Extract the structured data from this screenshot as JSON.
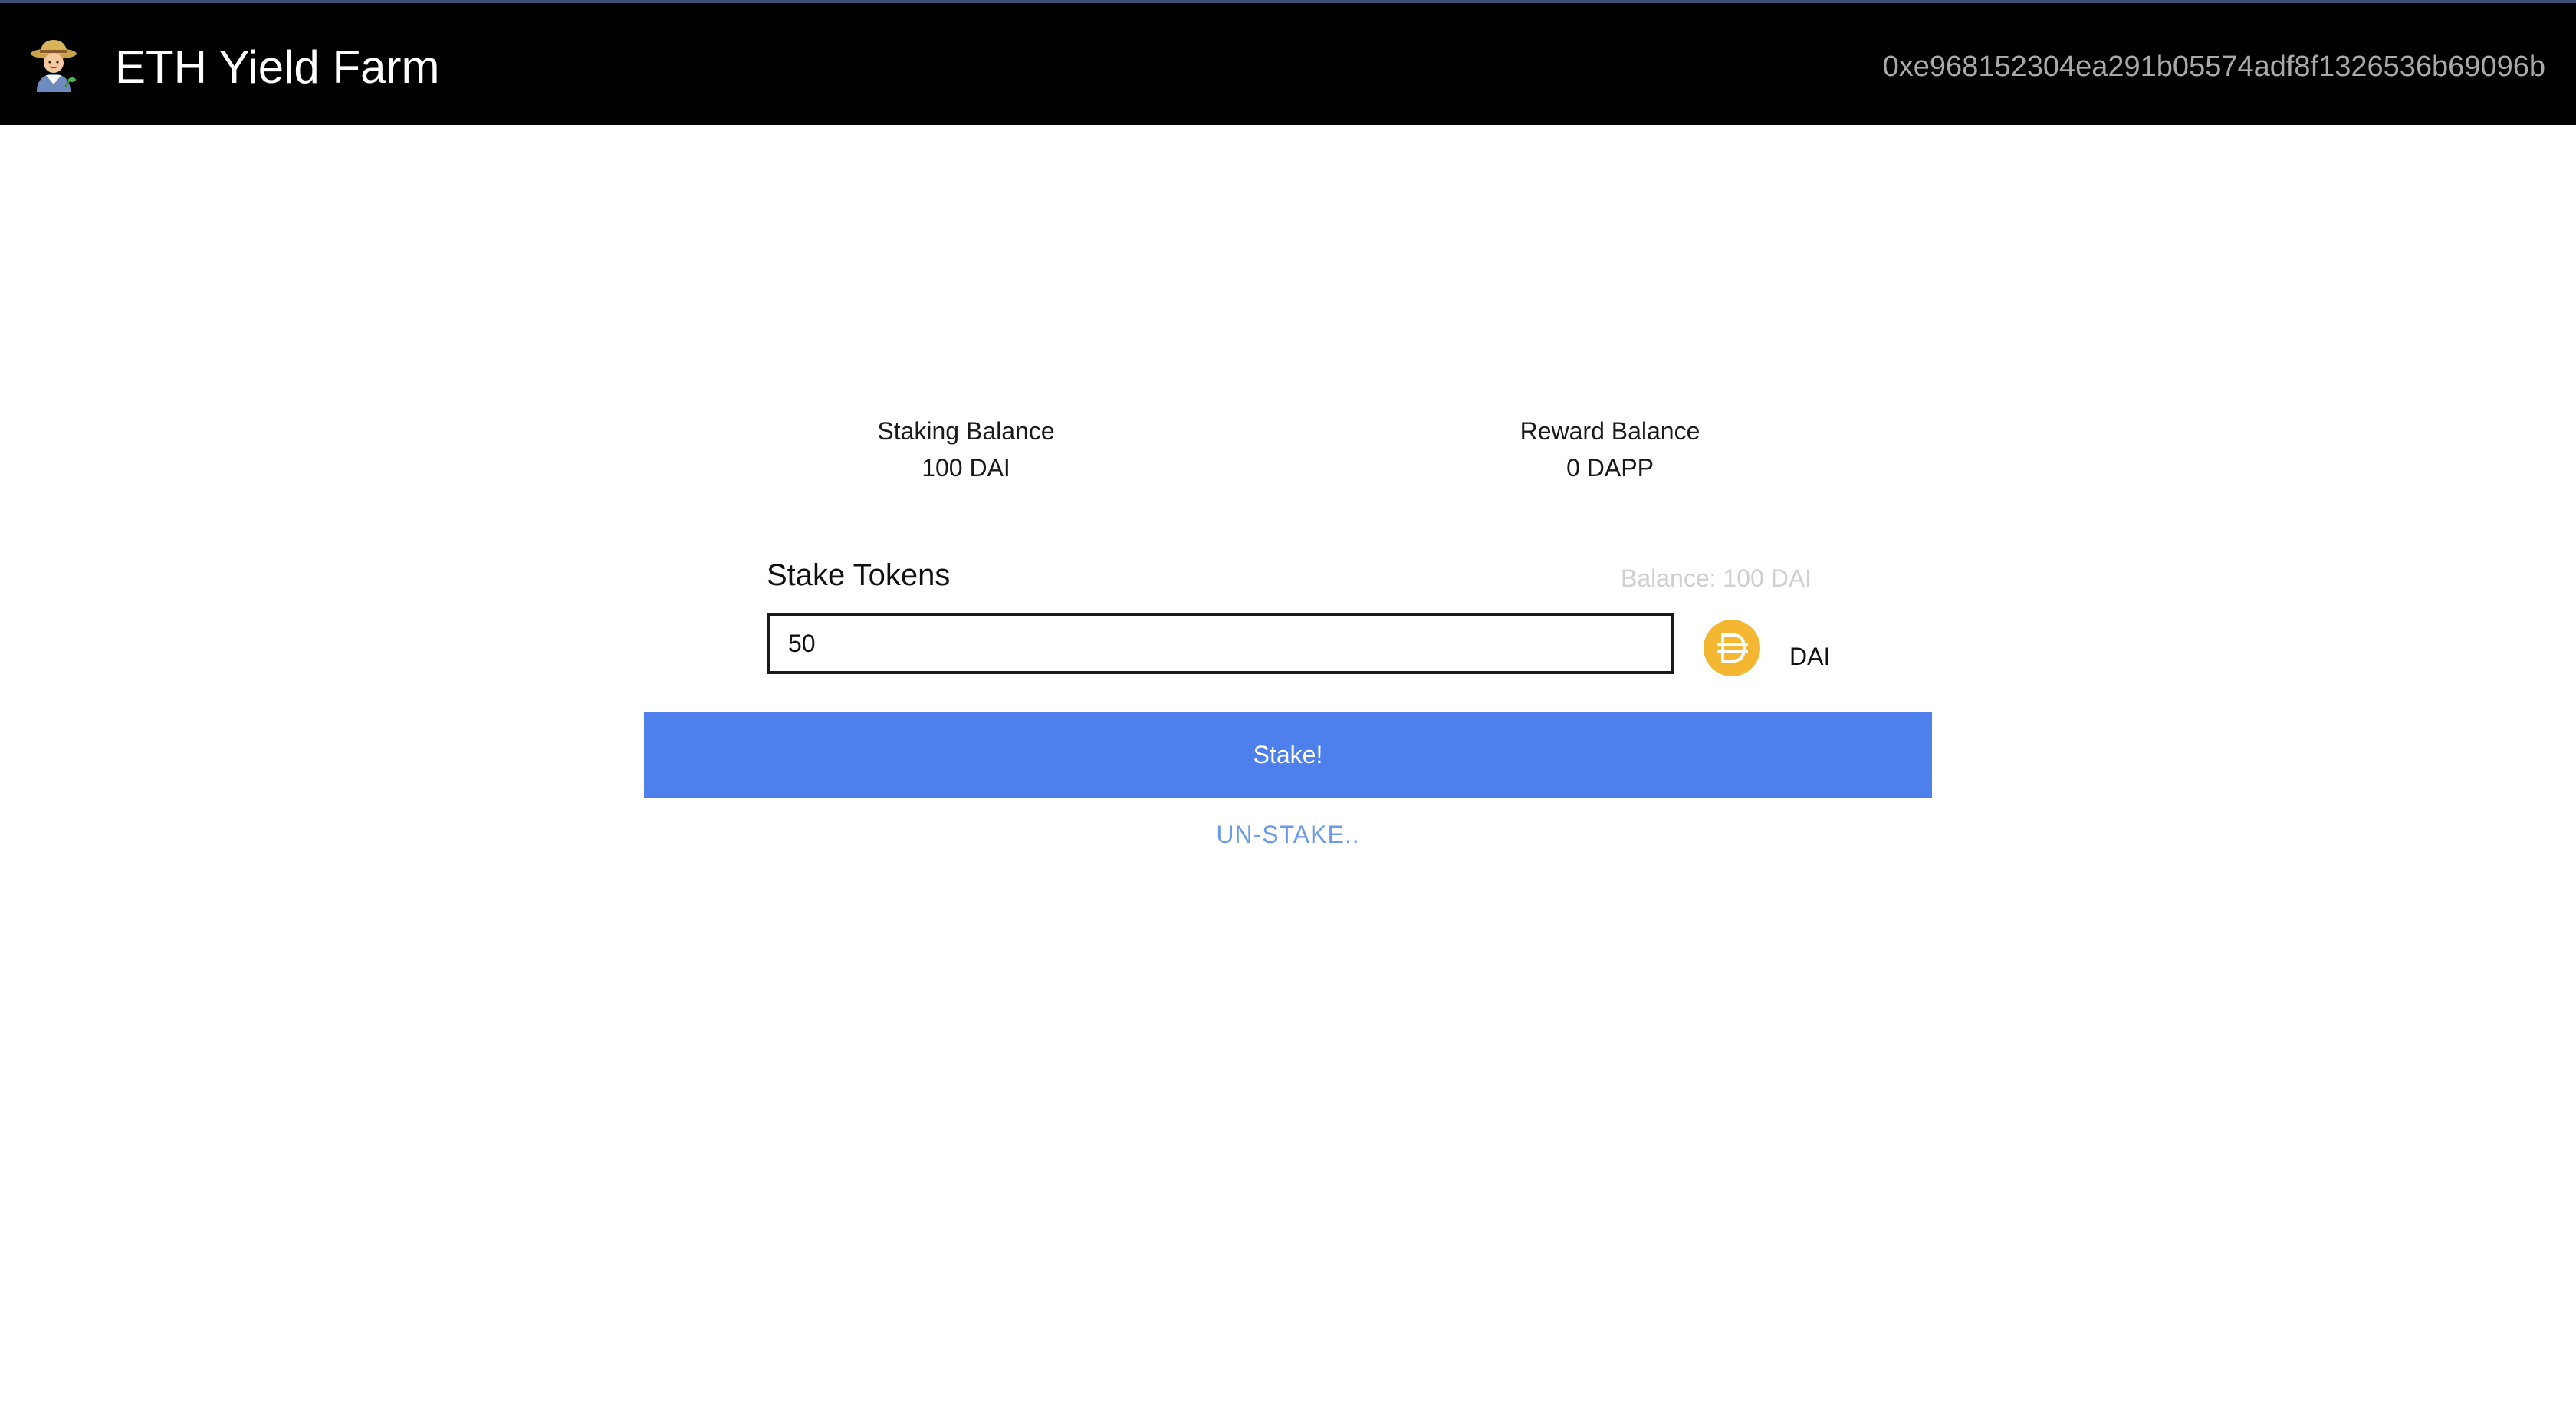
{
  "navbar": {
    "brand_icon": "farmer-emoji-icon",
    "title": "ETH Yield Farm",
    "account": "0xe968152304ea291b05574adf8f1326536b69096b"
  },
  "balances": {
    "staking_label": "Staking Balance",
    "staking_value": "100 DAI",
    "reward_label": "Reward Balance",
    "reward_value": "0 DAPP"
  },
  "stake_form": {
    "heading": "Stake Tokens",
    "balance_hint": "Balance: 100 DAI",
    "amount_value": "50",
    "token_icon": "dai-token-icon",
    "token_label": "DAI",
    "stake_button": "Stake!",
    "unstake_link": "UN-STAKE.."
  },
  "colors": {
    "navbar_bg": "#000000",
    "primary_button": "#4e80ec",
    "link": "#6a9be6",
    "dai_gold": "#f4b731"
  }
}
